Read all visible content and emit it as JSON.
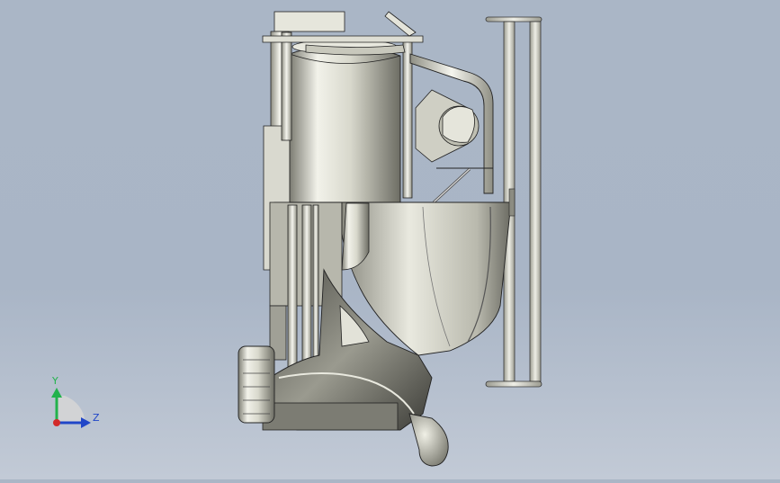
{
  "viewport": {
    "background_top": "#aab6c6",
    "background_bottom": "#c2cad6",
    "model_shade_light": "#f4f4ec",
    "model_shade_mid": "#c9c9bd",
    "model_shade_dark": "#5e5e57",
    "edge_color": "#1f1f1c"
  },
  "triad": {
    "y_label": "Y",
    "z_label": "Z",
    "y_color": "#22b24c",
    "z_color": "#2046c8",
    "x_color": "#d22a2a"
  }
}
